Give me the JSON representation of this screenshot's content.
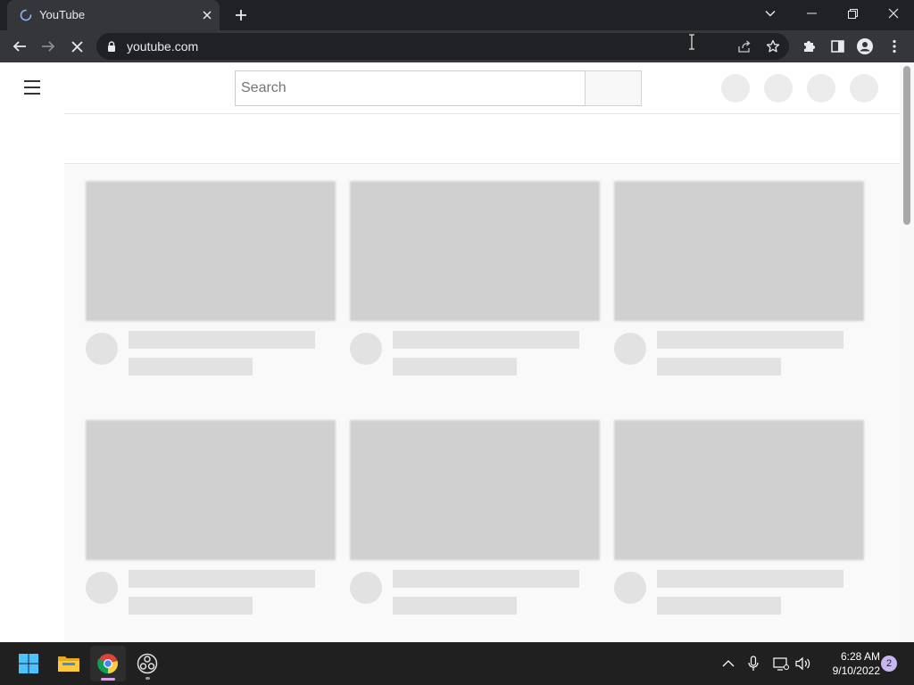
{
  "browser": {
    "tab": {
      "title": "YouTube",
      "loading": true
    },
    "address_bar": {
      "url": "youtube.com"
    }
  },
  "page": {
    "search": {
      "placeholder": "Search"
    },
    "video_grid": {
      "rows": 2,
      "columns": 3,
      "loading_skeleton": true
    }
  },
  "taskbar": {
    "apps": [
      "start-icon",
      "file-explorer-icon",
      "chrome-icon",
      "obs-icon"
    ],
    "clock": {
      "time": "6:28 AM",
      "date": "9/10/2022"
    },
    "notification_count": "2"
  },
  "colors": {
    "chrome_dark": "#202124",
    "chrome_toolbar": "#35363a",
    "skeleton_thumb": "#d0d0d0",
    "skeleton_line": "#e2e2e2",
    "taskbar": "#202020",
    "badge": "#c8b6f2"
  }
}
